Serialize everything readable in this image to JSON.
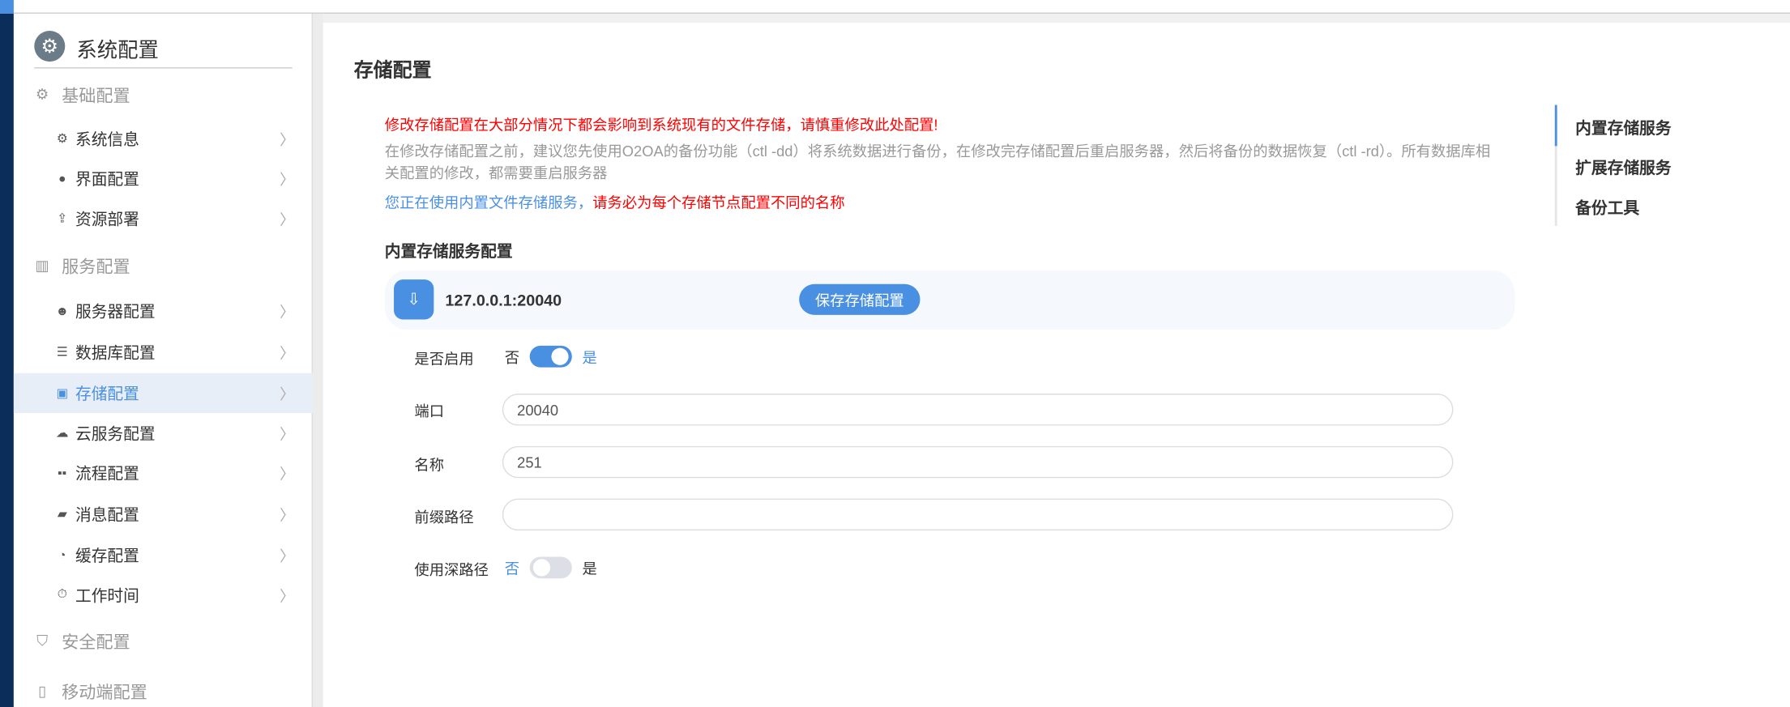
{
  "sidebar": {
    "title": "系统配置",
    "groups": [
      {
        "label": "基础配置",
        "icon": "gear-icon",
        "items": [
          {
            "label": "系统信息",
            "icon": "gear-icon"
          },
          {
            "label": "界面配置",
            "icon": "palette-icon"
          },
          {
            "label": "资源部署",
            "icon": "upload-icon"
          }
        ]
      },
      {
        "label": "服务配置",
        "icon": "server-icon",
        "items": [
          {
            "label": "服务器配置",
            "icon": "user-gear-icon"
          },
          {
            "label": "数据库配置",
            "icon": "database-icon"
          },
          {
            "label": "存储配置",
            "icon": "storage-icon",
            "active": true
          },
          {
            "label": "云服务配置",
            "icon": "cloud-icon"
          },
          {
            "label": "流程配置",
            "icon": "flow-icon"
          },
          {
            "label": "消息配置",
            "icon": "message-icon"
          },
          {
            "label": "缓存配置",
            "icon": "pie-icon"
          },
          {
            "label": "工作时间",
            "icon": "stopwatch-icon"
          }
        ]
      },
      {
        "label": "安全配置",
        "icon": "shield-icon",
        "items": []
      },
      {
        "label": "移动端配置",
        "icon": "mobile-icon",
        "items": []
      }
    ]
  },
  "main": {
    "title": "存储配置",
    "warning": "修改存储配置在大部分情况下都会影响到系统现有的文件存储，请慎重修改此处配置!",
    "note": "在修改存储配置之前，建议您先使用O2OA的备份功能（ctl -dd）将系统数据进行备份，在修改完存储配置后重启服务器，然后将备份的数据恢复（ctl -rd）。所有数据库相关配置的修改，都需要重启服务器",
    "using_blue": "您正在使用内置文件存储服务，",
    "using_red": "请务必为每个存储节点配置不同的名称",
    "section_title": "内置存储服务配置",
    "node": {
      "address": "127.0.0.1:20040",
      "save_label": "保存存储配置"
    },
    "form": {
      "enable": {
        "label": "是否启用",
        "off": "否",
        "on": "是",
        "value": true
      },
      "port": {
        "label": "端口",
        "value": "20040"
      },
      "name": {
        "label": "名称",
        "value": "251"
      },
      "prefix": {
        "label": "前缀路径",
        "value": ""
      },
      "deep": {
        "label": "使用深路径",
        "off": "否",
        "on": "是",
        "value": false
      }
    }
  },
  "right_nav": [
    {
      "label": "内置存储服务",
      "active": true
    },
    {
      "label": "扩展存储服务"
    },
    {
      "label": "备份工具"
    }
  ],
  "colors": {
    "accent": "#4a90e2",
    "warning": "#ff0000",
    "nav": "#0b2d5a"
  }
}
